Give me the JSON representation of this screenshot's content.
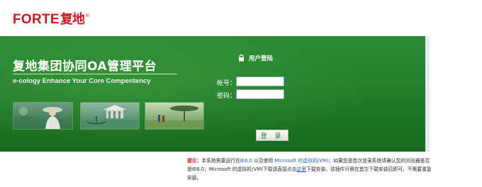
{
  "brand": {
    "name_en": "FORTE",
    "name_cn": "复地",
    "reg_mark": "®"
  },
  "banner": {
    "title": "复地集团协同OA管理平台",
    "subtitle": "e-cology Enhance Your Core Compentency"
  },
  "login": {
    "heading": "用户登陆",
    "username_label": "帐号：",
    "username_value": "",
    "password_label": "密码：",
    "password_value": "",
    "submit_label": "登 录"
  },
  "notice": {
    "lead": "提示：",
    "text1": "本系统需要运行在",
    "ie_version": "IE6.0",
    "text2": "以及使用",
    "vm_name": "Microsoft 的虚拟机(VM)",
    "text3": "；如果您是首次登录系统请确认您的浏览器是否是IE6.0；Microsoft 的虚拟机(VM)下载请直接点击",
    "link_text": "这里",
    "text4": "下载安装，该插件只需在首次下载安装后即可，不需要重复安装。"
  },
  "icons": [
    "lock-icon"
  ],
  "colors": {
    "brand_red": "#d0161e",
    "banner_green": "#23802c",
    "link_blue": "#2a5fb3"
  }
}
